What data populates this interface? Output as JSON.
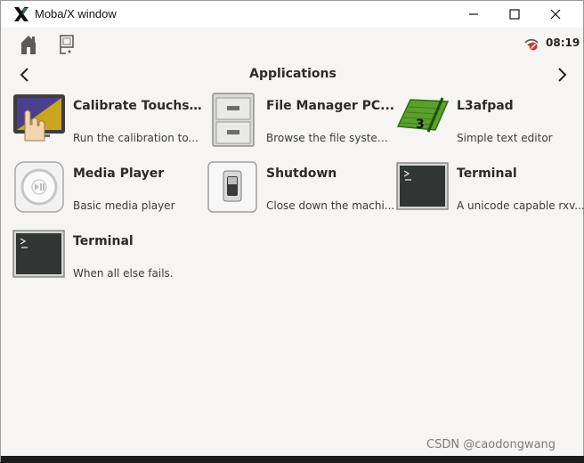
{
  "window": {
    "title": "Moba/X window"
  },
  "toolbar": {
    "clock": "08:19"
  },
  "main": {
    "heading": "Applications"
  },
  "apps": [
    {
      "name": "Calibrate Touchs...",
      "description": "Run the calibration to...",
      "icon": "touch-calibration-icon"
    },
    {
      "name": "File Manager PC...",
      "description": "Browse the file system...",
      "icon": "file-cabinet-icon"
    },
    {
      "name": "L3afpad",
      "description": "Simple text editor",
      "icon": "text-editor-icon"
    },
    {
      "name": "Media Player",
      "description": "Basic media player",
      "icon": "media-player-icon"
    },
    {
      "name": "Shutdown",
      "description": "Close down the machi...",
      "icon": "power-switch-icon"
    },
    {
      "name": "Terminal",
      "description": "A unicode capable rxv...",
      "icon": "terminal-icon"
    },
    {
      "name": "Terminal",
      "description": "When all else fails.",
      "icon": "terminal-icon"
    }
  ],
  "watermark": "CSDN @caodongwang",
  "colors": {
    "window_bg": "#f6f5f3",
    "titlebar_bg": "#ffffff",
    "text": "#2b2b2b",
    "l3afpad_green": "#5aa02c"
  }
}
